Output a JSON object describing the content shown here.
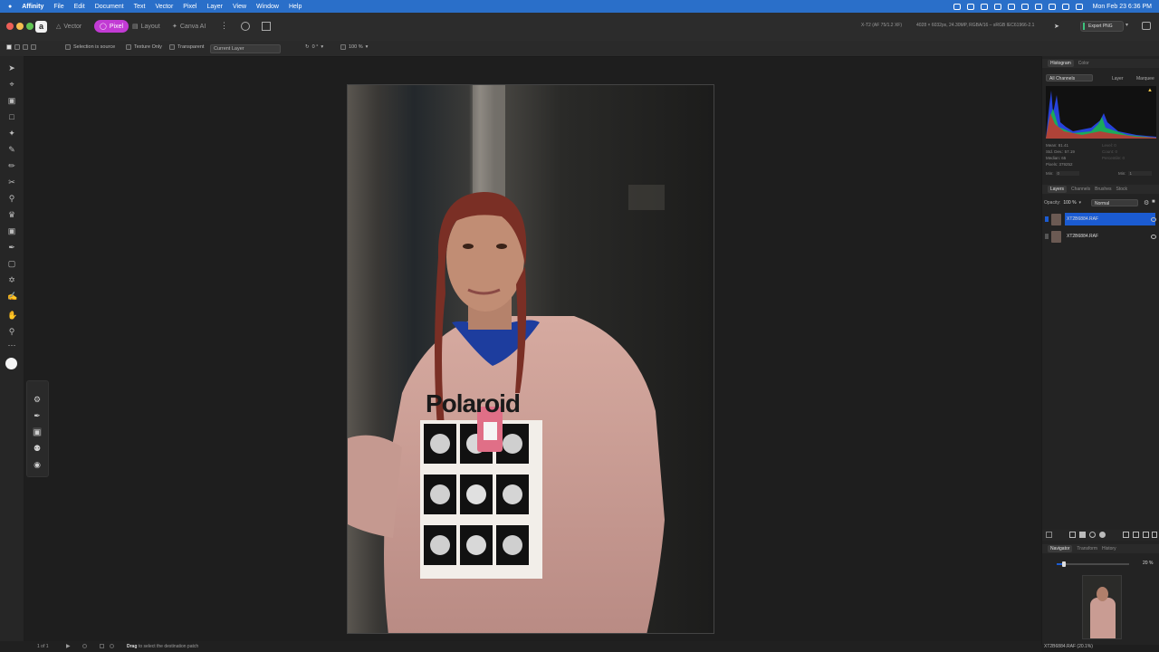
{
  "menubar": {
    "app_name": "Affinity",
    "items": [
      "File",
      "Edit",
      "Document",
      "Text",
      "Vector",
      "Pixel",
      "Layer",
      "View",
      "Window",
      "Help"
    ],
    "datetime": "Mon Feb 23  6:36 PM"
  },
  "toolbar": {
    "personas": [
      "Vector",
      "Pixel",
      "Layout",
      "Canva AI"
    ],
    "active_persona": "Pixel",
    "camera_info": "X-T2 (AF 75/1.2 XF)",
    "doc_info": "4028 × 6032px, 24.30MP, RGBA/16 – sRGB IEC61966-2.1",
    "export_label": "Export PNG"
  },
  "context": {
    "selection_is_source": "Selection is source",
    "texture_only": "Texture Only",
    "transparent": "Transparent",
    "layer_source": "Current Layer",
    "rotation": "0 °",
    "scale": "100 %"
  },
  "histogram": {
    "tabs": [
      "Histogram",
      "Color"
    ],
    "channel": "All Channels",
    "layer_label": "Layer",
    "marquee_label": "Marquee",
    "mean": "Mean: 81.41",
    "std_dev": "Std. Dev.: 57.19",
    "median": "Median: 65",
    "pixels": "Pixels: 379252",
    "level": "Level: 0",
    "count": "Count: 0",
    "percentile": "Percentile: 0",
    "min_left": "Min:",
    "min_left_val": "0",
    "min_right": "Min:",
    "min_right_val": "1"
  },
  "layers": {
    "tabs": [
      "Layers",
      "Channels",
      "Brushes",
      "Stock"
    ],
    "opacity_label": "Opacity:",
    "opacity": "100 %",
    "blend": "Normal",
    "items": [
      {
        "name": "XT2B6884.RAF",
        "selected": true
      },
      {
        "name": "XT2B6884.RAF",
        "selected": false
      }
    ]
  },
  "navigator": {
    "tabs": [
      "Navigator",
      "Transform",
      "History"
    ],
    "zoom": "20 %",
    "file_label": "XT2B6884.RAF (20.1%)"
  },
  "canvas": {
    "hoodie_text": "Polaroid"
  },
  "status": {
    "page": "1 of 1",
    "hint_bold": "Drag",
    "hint": "to select the destination patch"
  },
  "colors": {
    "accent": "#c23bd4",
    "selection": "#1b5bd1",
    "menubar": "#2a6fc9"
  }
}
